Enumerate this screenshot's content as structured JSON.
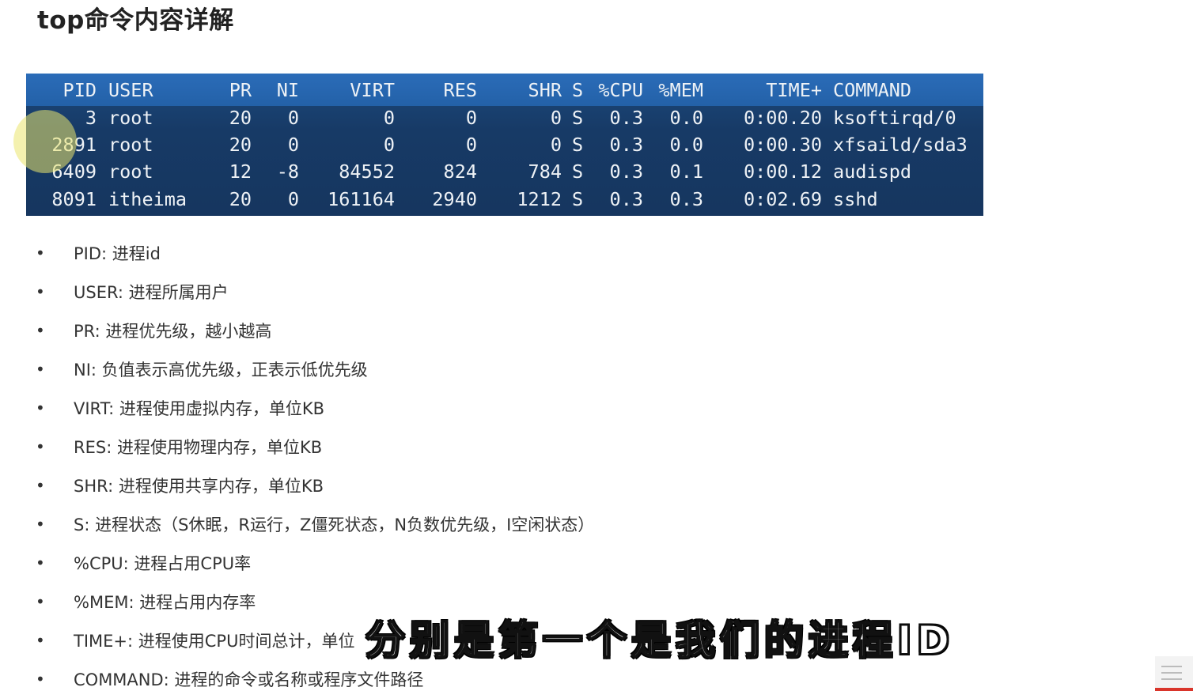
{
  "title": "top命令内容详解",
  "top_table": {
    "headers": [
      "PID",
      "USER",
      "PR",
      "NI",
      "VIRT",
      "RES",
      "SHR",
      "S",
      "%CPU",
      "%MEM",
      "TIME+",
      "COMMAND"
    ],
    "rows": [
      [
        "3",
        "root",
        "20",
        "0",
        "0",
        "0",
        "0",
        "S",
        "0.3",
        "0.0",
        "0:00.20",
        "ksoftirqd/0"
      ],
      [
        "2891",
        "root",
        "20",
        "0",
        "0",
        "0",
        "0",
        "S",
        "0.3",
        "0.0",
        "0:00.30",
        "xfsaild/sda3"
      ],
      [
        "6409",
        "root",
        "12",
        "-8",
        "84552",
        "824",
        "784",
        "S",
        "0.3",
        "0.1",
        "0:00.12",
        "audispd"
      ],
      [
        "8091",
        "itheima",
        "20",
        "0",
        "161164",
        "2940",
        "1212",
        "S",
        "0.3",
        "0.3",
        "0:02.69",
        "sshd"
      ]
    ]
  },
  "bullets": [
    "PID: 进程id",
    "USER: 进程所属用户",
    "PR: 进程优先级，越小越高",
    "NI: 负值表示高优先级，正表示低优先级",
    "VIRT: 进程使用虚拟内存，单位KB",
    "RES: 进程使用物理内存，单位KB",
    "SHR: 进程使用共享内存，单位KB",
    "S: 进程状态（S休眠，R运行，Z僵死状态，N负数优先级，I空闲状态）",
    "%CPU: 进程占用CPU率",
    "%MEM: 进程占用内存率",
    "TIME+: 进程使用CPU时间总计，单位",
    "COMMAND: 进程的命令或名称或程序文件路径"
  ],
  "subtitle": "分别是第一个是我们的进程ID",
  "colors": {
    "table_header_bg": "#2b6cb8",
    "table_body_bg": "#173a66",
    "table_text": "#eef2f6",
    "body_text": "#333333",
    "accent_red": "#d9352b"
  }
}
